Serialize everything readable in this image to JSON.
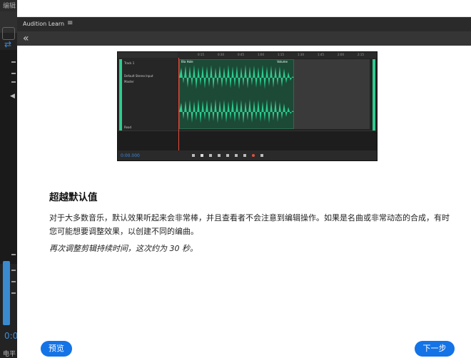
{
  "background_app": {
    "menu_label": "编辑",
    "time_readout": "0:0",
    "bottom_label": "电平"
  },
  "learn_panel": {
    "title": "Audition Learn",
    "menu_icon": "hamburger-icon",
    "back_icon": "double-chevron-left-icon"
  },
  "screenshot": {
    "track_label": "Track 1",
    "input_label": "Default Stereo Input",
    "output_label": "Master",
    "read_label": "Read",
    "master_label": "Master",
    "clip_label": "Bla Hole",
    "volume_label": "Volume",
    "time": "0:00.000",
    "ruler": [
      "0:15",
      "0:30",
      "0:45",
      "1:00",
      "1:15",
      "1:30",
      "1:45",
      "2:00",
      "2:15",
      "2:30"
    ],
    "waveform_color": "#2ecc8f"
  },
  "content": {
    "heading": "超越默认值",
    "paragraph": "对于大多数音乐，默认效果听起来会非常棒，并且查看者不会注意到编辑操作。如果是名曲或非常动态的合成，有时您可能想要调整效果，以创建不同的编曲。",
    "italic_note": "再次调整剪辑持续时间，这次约为 30 秒。"
  },
  "buttons": {
    "preview": "预览",
    "next": "下一步"
  },
  "colors": {
    "accent": "#1473e6",
    "waveform": "#2ecc8f",
    "dark_ui": "#2a2a2a"
  }
}
